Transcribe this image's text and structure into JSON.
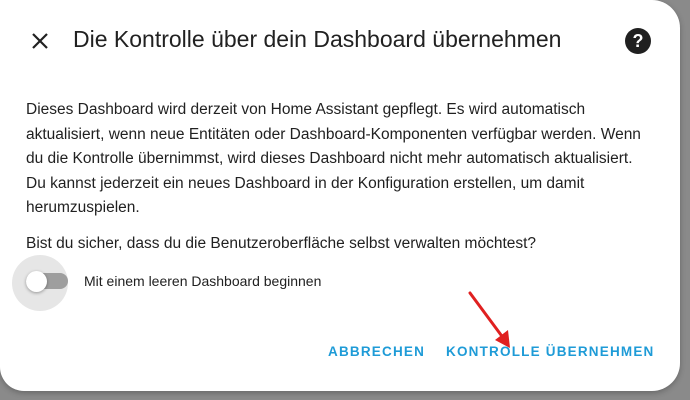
{
  "backdrop": {
    "text": "— — — — — — — —"
  },
  "dialog": {
    "title": "Die Kontrolle über dein Dashboard übernehmen",
    "close_icon": "close-icon",
    "help_icon": "help-circle-icon",
    "help_glyph": "?",
    "paragraph": "Dieses Dashboard wird derzeit von Home Assistant gepflegt. Es wird automatisch aktualisiert, wenn neue Entitäten oder Dashboard-Komponenten verfügbar werden. Wenn du die Kontrolle übernimmst, wird dieses Dashboard nicht mehr automatisch aktualisiert. Du kannst jederzeit ein neues Dashboard in der Konfiguration erstellen, um damit herumzuspielen.",
    "question": "Bist du sicher, dass du die Benutzeroberfläche selbst verwalten möchtest?",
    "toggle": {
      "label": "Mit einem leeren Dashboard beginnen",
      "checked": false
    },
    "buttons": {
      "cancel": "ABBRECHEN",
      "take_control": "KONTROLLE ÜBERNEHMEN"
    }
  },
  "colors": {
    "accent": "#1e9bd7",
    "annotation_arrow": "#e02020",
    "backdrop": "#8a8a8a"
  }
}
